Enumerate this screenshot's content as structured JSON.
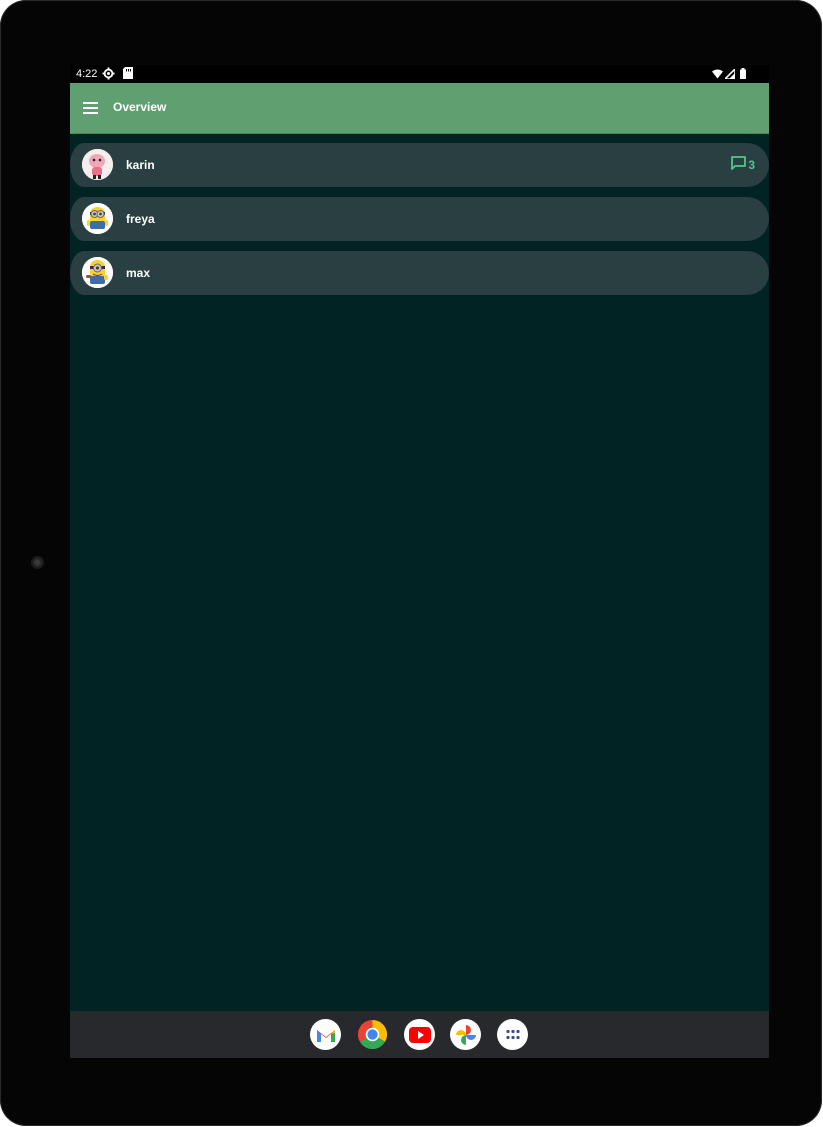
{
  "status_bar": {
    "time": "4:22",
    "left_icons": [
      "settings-gear-icon",
      "sd-card-icon"
    ],
    "right_icons": [
      "wifi-icon",
      "cellular-signal-icon",
      "battery-icon"
    ]
  },
  "app_bar": {
    "title": "Overview",
    "menu_icon": "hamburger-menu-icon",
    "color": "#60a070"
  },
  "conversations": [
    {
      "name": "karin",
      "avatar": "pink-cartoon-avatar",
      "unread": "3"
    },
    {
      "name": "freya",
      "avatar": "minion-avatar",
      "unread": null
    },
    {
      "name": "max",
      "avatar": "minion-avatar",
      "unread": null
    }
  ],
  "colors": {
    "background": "#012324",
    "list_item": "#2a3f42",
    "accent": "#4ec98a",
    "nav_bar": "#28292d"
  },
  "dock": {
    "apps": [
      "gmail-icon",
      "chrome-icon",
      "youtube-icon",
      "photos-icon",
      "app-drawer-icon"
    ]
  }
}
